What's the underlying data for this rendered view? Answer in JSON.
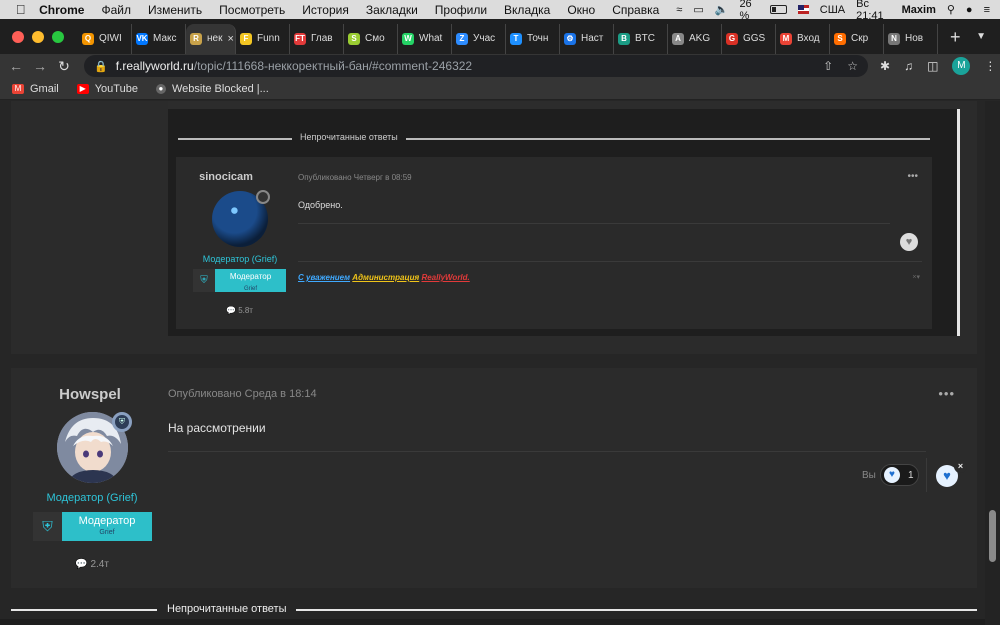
{
  "menubar": {
    "app": "Chrome",
    "items": [
      "Файл",
      "Изменить",
      "Посмотреть",
      "История",
      "Закладки",
      "Профили",
      "Вкладка",
      "Окно",
      "Справка"
    ],
    "battery": "26 %",
    "keyboard": "США",
    "clock": "Вс 21:41",
    "user": "Maxim"
  },
  "tabs": [
    {
      "label": "QIWI",
      "color": "#f29400",
      "glyph": "Q"
    },
    {
      "label": "Макс",
      "color": "#0077ff",
      "glyph": "VK"
    },
    {
      "label": "нек",
      "color": "#c8a24a",
      "glyph": "R",
      "active": true
    },
    {
      "label": "Funn",
      "color": "#f3c623",
      "glyph": "F"
    },
    {
      "label": "Глав",
      "color": "#e23a3a",
      "glyph": "FT"
    },
    {
      "label": "Смо",
      "color": "#9acd32",
      "glyph": "S"
    },
    {
      "label": "What",
      "color": "#25d366",
      "glyph": "W"
    },
    {
      "label": "Учас",
      "color": "#2d8cff",
      "glyph": "Z"
    },
    {
      "label": "Точн",
      "color": "#1e90ff",
      "glyph": "T"
    },
    {
      "label": "Наст",
      "color": "#1a73e8",
      "glyph": "⚙"
    },
    {
      "label": "BTC",
      "color": "#1b9c85",
      "glyph": "B"
    },
    {
      "label": "AKG",
      "color": "#888888",
      "glyph": "A"
    },
    {
      "label": "GGS",
      "color": "#d93025",
      "glyph": "G"
    },
    {
      "label": "Вход",
      "color": "#ea4335",
      "glyph": "M"
    },
    {
      "label": "Скр",
      "color": "#ff6d00",
      "glyph": "S"
    },
    {
      "label": "Нов",
      "color": "#777777",
      "glyph": "N"
    }
  ],
  "address": {
    "host": "f.reallyworld.ru",
    "path": "/topic/111668-неккоректный-бан/#comment-246322"
  },
  "profile_initial": "M",
  "bookmarks": [
    {
      "label": "Gmail",
      "color": "#ea4335",
      "glyph": "M"
    },
    {
      "label": "YouTube",
      "color": "#ff0000",
      "glyph": "▶"
    },
    {
      "label": "Website Blocked |...",
      "color": "#666666",
      "glyph": "●"
    }
  ],
  "quoted": {
    "divider_label": "Непрочитанные ответы",
    "author": "sinocicam",
    "meta": "Опубликовано Четверг в 08:59",
    "text": "Одобрено.",
    "role": "Модератор (Grief)",
    "group": "Модератор",
    "group_sub": "Grief",
    "posts": "5.8т",
    "signature": {
      "p1": "С уважением",
      "p2": "Администрация",
      "p3": "ReallyWorld."
    }
  },
  "post": {
    "author": "Howspel",
    "meta": "Опубликовано Среда в 18:14",
    "text": "На рассмотрении",
    "role": "Модератор (Grief)",
    "group": "Модератор",
    "group_sub": "Grief",
    "posts": "2.4т",
    "reaction_by": "Вы",
    "reaction_count": "1"
  },
  "divider_label": "Непрочитанные ответы"
}
